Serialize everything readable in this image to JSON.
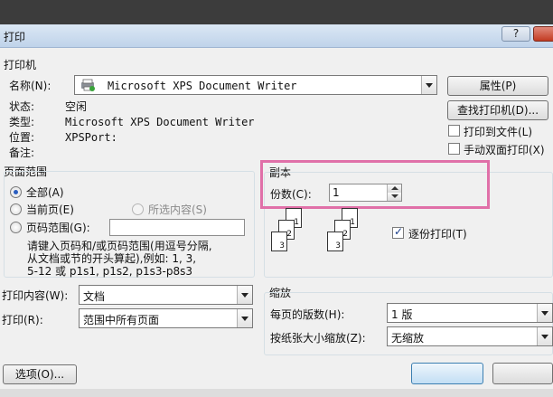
{
  "window": {
    "title": "打印",
    "help_label": "?"
  },
  "printer": {
    "group_label": "打印机",
    "name_label": "名称(N):",
    "name_value": "Microsoft XPS Document Writer",
    "status_label": "状态:",
    "status_value": "空闲",
    "type_label": "类型:",
    "type_value": "Microsoft XPS Document Writer",
    "location_label": "位置:",
    "location_value": "XPSPort:",
    "comment_label": "备注:",
    "properties_button": "属性(P)",
    "find_printer_button": "查找打印机(D)...",
    "print_to_file_label": "打印到文件(L)",
    "print_to_file_checked": false,
    "manual_duplex_label": "手动双面打印(X)",
    "manual_duplex_checked": false
  },
  "page_range": {
    "group_label": "页面范围",
    "all_label": "全部(A)",
    "current_page_label": "当前页(E)",
    "selection_label": "所选内容(S)",
    "pages_label": "页码范围(G):",
    "pages_value": "",
    "selected": "all",
    "hint": [
      "请键入页码和/或页码范围(用逗号分隔,",
      "从文档或节的开头算起),例如: 1, 3,",
      "5-12 或 p1s1, p1s2, p1s3-p8s3"
    ]
  },
  "copies": {
    "group_label": "副本",
    "count_label": "份数(C):",
    "count_value": "1",
    "collate_label": "逐份打印(T)",
    "collate_checked": true,
    "page_numbers": [
      "1",
      "2",
      "3",
      "1",
      "2",
      "3"
    ]
  },
  "print_what": {
    "content_label": "打印内容(W):",
    "content_value": "文档",
    "print_label": "打印(R):",
    "print_value": "范围中所有页面"
  },
  "zoom": {
    "group_label": "缩放",
    "pages_per_sheet_label": "每页的版数(H):",
    "pages_per_sheet_value": "1 版",
    "scale_to_paper_label": "按纸张大小缩放(Z):",
    "scale_to_paper_value": "无缩放"
  },
  "footer": {
    "options_button": "选项(O)...",
    "ok_button": "",
    "cancel_button": ""
  }
}
